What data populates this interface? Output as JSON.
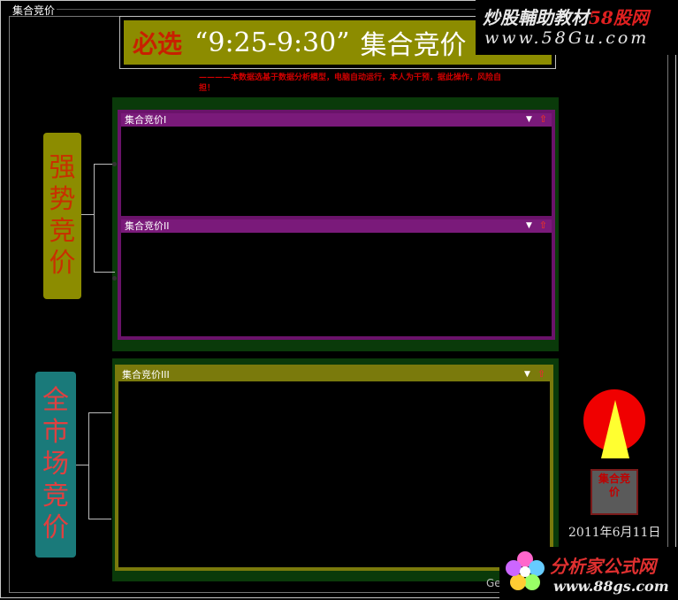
{
  "window": {
    "title": "集合竞价"
  },
  "banner": {
    "prefix": "必选",
    "time_range": "“9:25-9:30”",
    "name": "集合竞价"
  },
  "watermark_top": {
    "line1_text": "炒股輔助教材",
    "line1_number": "58股网",
    "line2": "www.58Gu.com"
  },
  "disclaimer": "————本数据选基于数据分析模型，电脑自动运行，本人为干预，据此操作，风险自担！",
  "labels": {
    "left_top": [
      "强",
      "势",
      "竞",
      "价"
    ],
    "left_bottom": [
      "全",
      "市",
      "场",
      "竞",
      "价"
    ]
  },
  "panels": [
    {
      "title": "集合竞价I"
    },
    {
      "title": "集合竞价II"
    },
    {
      "title": "集合竞价III"
    }
  ],
  "controls": {
    "down_glyph": "▼",
    "up_glyph": "⇧"
  },
  "seal": {
    "text": "集合竞价"
  },
  "date": "2011年6月11日",
  "watermark_bottom": {
    "line1": "分析家公式网",
    "line2": "www.88gs.com",
    "partial": "Geo"
  },
  "colors": {
    "panel_purple": "#7a1a7a",
    "panel_olive": "#7a7a0c",
    "green_bg": "#0a3a0a",
    "banner_bg": "#8c8c00",
    "label_teal": "#1a7a7a",
    "logo_red": "#f00000",
    "logo_yellow": "#ffff30"
  }
}
